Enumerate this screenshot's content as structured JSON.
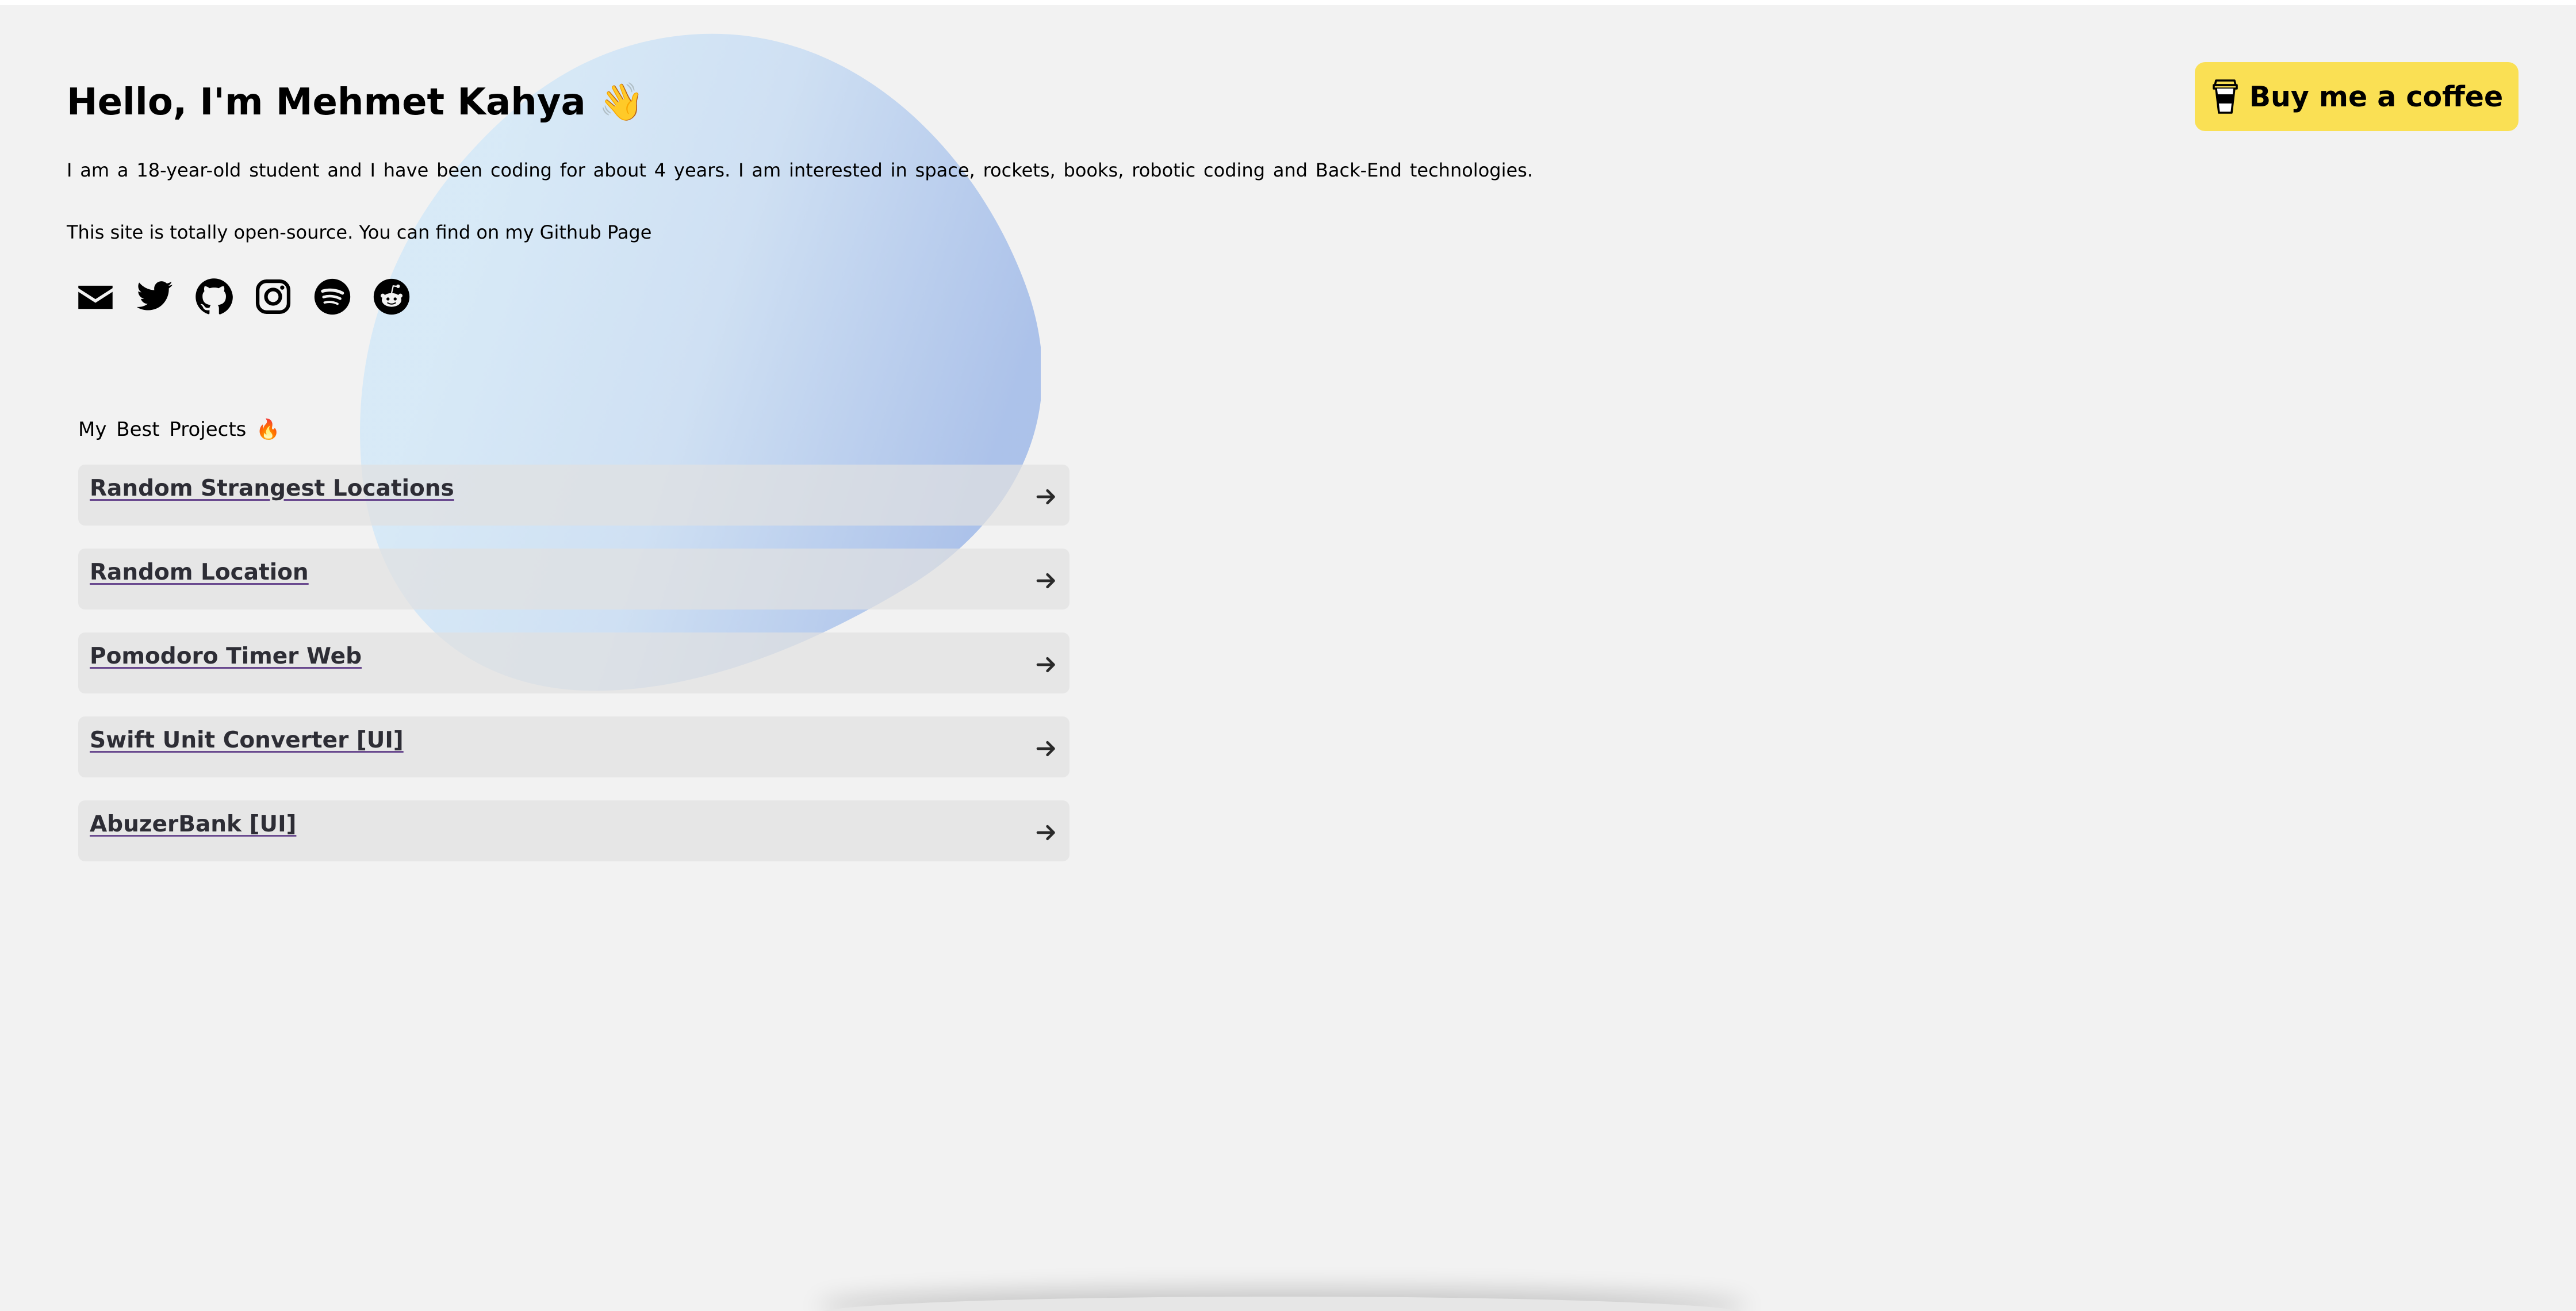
{
  "theme": {
    "background": "#f2f2f2",
    "accent": "#fae054",
    "blob_light": "#d3e6f5",
    "blob_dark": "#a7bee8",
    "card_background": "#e6e6e6",
    "link_underline": "#6a4a8f"
  },
  "intro": {
    "headline": "Hello, I'm Mehmet Kahya 👋",
    "bio": "I am a 18-year-old student and I have been coding for about 4 years. I am interested in space, rockets, books, robotic coding and Back-End technologies.",
    "note_prefix": "This site is totally open-source. You can find on my",
    "note_link": "Github Page"
  },
  "socials": [
    {
      "name": "email",
      "icon": "envelope-icon"
    },
    {
      "name": "twitter",
      "icon": "twitter-icon"
    },
    {
      "name": "github",
      "icon": "github-icon"
    },
    {
      "name": "instagram",
      "icon": "instagram-icon"
    },
    {
      "name": "spotify",
      "icon": "spotify-icon"
    },
    {
      "name": "reddit",
      "icon": "reddit-icon"
    }
  ],
  "projects": {
    "heading": "My Best Projects 🔥",
    "items": [
      {
        "title": "Random Strangest Locations",
        "icon": "arrow-right-icon"
      },
      {
        "title": "Random Location",
        "icon": "arrow-right-icon"
      },
      {
        "title": "Pomodoro Timer Web",
        "icon": "arrow-right-icon"
      },
      {
        "title": "Swift Unit Converter [UI]",
        "icon": "arrow-right-icon"
      },
      {
        "title": "AbuzerBank [UI]",
        "icon": "arrow-right-icon"
      }
    ]
  },
  "coffee": {
    "label": "Buy me a coffee",
    "icon": "coffee-cup-icon"
  }
}
